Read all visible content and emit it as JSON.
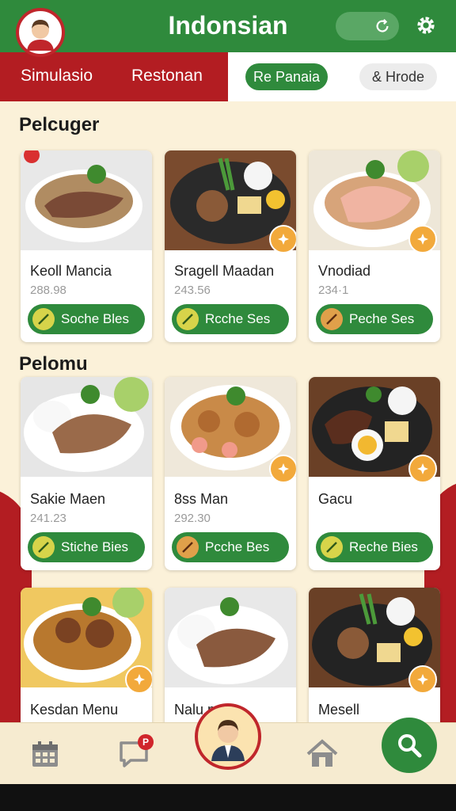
{
  "header": {
    "title": "Indonsian"
  },
  "nav": {
    "tabs": [
      "Simulasio",
      "Restonan"
    ],
    "pill_active": "Re Panaia",
    "pill_plain": "& Hrode"
  },
  "sections": [
    {
      "title": "Pelcuger",
      "cards": [
        {
          "name": "Keoll Mancia",
          "price": "288.98",
          "button": "Soche Bles"
        },
        {
          "name": "Sragell Maadan",
          "price": "243.56",
          "button": "Rcche Ses"
        },
        {
          "name": "Vnodiad",
          "price": "234·1",
          "button": "Peche Ses"
        }
      ]
    },
    {
      "title": "Pelomu",
      "cards": [
        {
          "name": "Sakie Maen",
          "price": "241.23",
          "button": "Stiche Bies"
        },
        {
          "name": "8ss Man",
          "price": "292.30",
          "button": "Pcche Bes"
        },
        {
          "name": "Gacu",
          "price": "",
          "button": "Reche Bies"
        }
      ]
    },
    {
      "title": "",
      "cards": [
        {
          "name": "Kesdan Menu",
          "price": "",
          "button": ""
        },
        {
          "name": "Nalu      m",
          "price": "",
          "button": ""
        },
        {
          "name": "Mesell",
          "price": "",
          "button": ""
        }
      ]
    }
  ],
  "bottom_nav": {
    "notification_badge": "P"
  },
  "colors": {
    "green": "#2f8a3c",
    "red": "#b31d22",
    "cream": "#fbf1d9",
    "badge": "#f2a93b"
  },
  "icons": [
    "user-avatar-icon",
    "refresh-icon",
    "gear-icon",
    "calendar-icon",
    "chat-icon",
    "home-icon",
    "search-icon",
    "star-badge-icon",
    "skewer-icon"
  ]
}
